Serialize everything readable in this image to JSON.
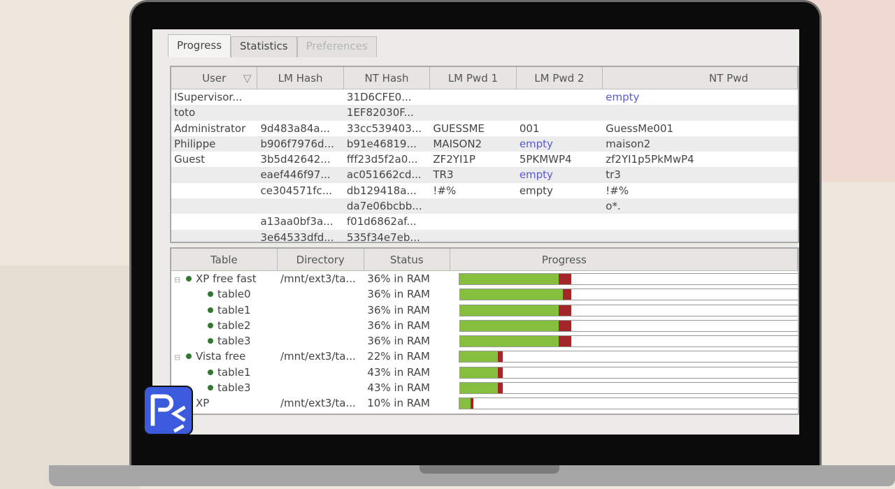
{
  "tabs": [
    {
      "label": "Progress",
      "state": "active"
    },
    {
      "label": "Statistics",
      "state": "normal"
    },
    {
      "label": "Preferences",
      "state": "disabled"
    }
  ],
  "users_table": {
    "columns": [
      "User",
      "LM Hash",
      "NT Hash",
      "LM Pwd 1",
      "LM Pwd 2",
      "NT Pwd"
    ],
    "rows": [
      [
        "ISupervisor...",
        "",
        "31D6CFE0...",
        "",
        "",
        "empty"
      ],
      [
        "toto",
        "",
        "1EF82030F...",
        "",
        "",
        ""
      ],
      [
        "Administrator",
        "9d483a84a...",
        "33cc539403...",
        "GUESSME",
        "001",
        "GuessMe001"
      ],
      [
        "Philippe",
        "b906f7976d...",
        "b91e46819...",
        "MAISON2",
        "empty",
        "maison2"
      ],
      [
        "Guest",
        "3b5d42642...",
        "fff23d5f2a0...",
        "ZF2YI1P",
        "5PKMWP4",
        "zf2YI1p5PkMwP4"
      ],
      [
        "",
        "eaef446f97...",
        "ac051662cd...",
        "TR3",
        "empty",
        "tr3"
      ],
      [
        "",
        "ce304571fc...",
        "db129418a...",
        "!#%",
        "empty",
        "!#%"
      ],
      [
        "",
        "",
        "da7e06bcbb...",
        "",
        "",
        "o*."
      ],
      [
        "",
        "a13aa0bf3a...",
        "f01d6862af...",
        "",
        "",
        ""
      ],
      [
        "",
        "3e64533dfd...",
        "535f34e7eb...",
        "",
        "",
        ""
      ]
    ]
  },
  "tables_table": {
    "columns": [
      "Table",
      "Directory",
      "Status",
      "Progress"
    ],
    "rows": [
      {
        "name": "XP free fast",
        "dir": "/mnt/ext3/ta...",
        "status": "36% in RAM",
        "level": 0,
        "done": 28.4,
        "current": 3.7
      },
      {
        "name": "table0",
        "dir": "",
        "status": "36% in RAM",
        "level": 1,
        "done": 29.6,
        "current": 2.5
      },
      {
        "name": "table1",
        "dir": "",
        "status": "36% in RAM",
        "level": 1,
        "done": 28.4,
        "current": 3.7
      },
      {
        "name": "table2",
        "dir": "",
        "status": "36% in RAM",
        "level": 1,
        "done": 28.4,
        "current": 3.7
      },
      {
        "name": "table3",
        "dir": "",
        "status": "36% in RAM",
        "level": 1,
        "done": 28.4,
        "current": 3.7
      },
      {
        "name": "Vista free",
        "dir": "/mnt/ext3/ta...",
        "status": "22% in RAM",
        "level": 0,
        "done": 11,
        "current": 1.4
      },
      {
        "name": "table1",
        "dir": "",
        "status": "43% in RAM",
        "level": 1,
        "done": 11,
        "current": 1.4
      },
      {
        "name": "table3",
        "dir": "",
        "status": "43% in RAM",
        "level": 1,
        "done": 11,
        "current": 1.4
      },
      {
        "name": "XP",
        "dir": "/mnt/ext3/ta...",
        "status": "10% in RAM",
        "level": 0,
        "done": 3.1,
        "current": 0.8
      }
    ]
  },
  "colors": {
    "done": "#85bf3d",
    "current": "#a2262a",
    "empty_text": "#5a5ad0"
  },
  "logo_text": "PC"
}
